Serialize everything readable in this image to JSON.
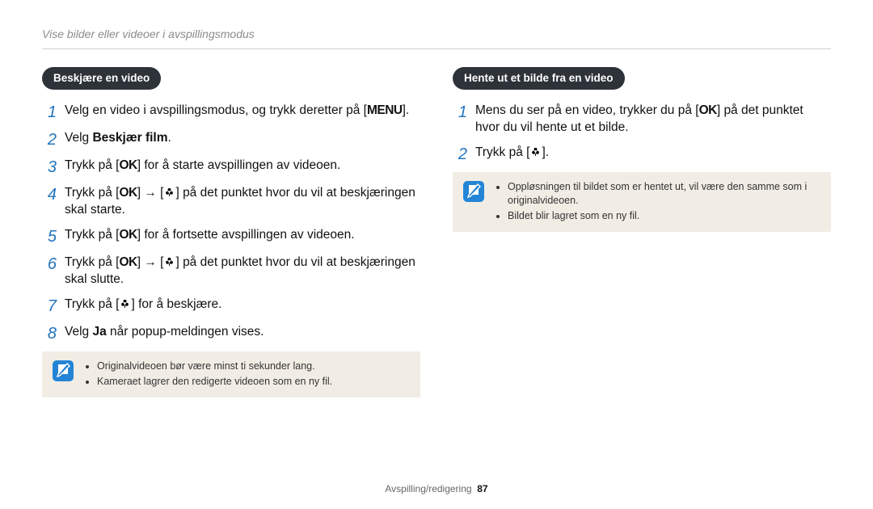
{
  "header": {
    "title": "Vise bilder eller videoer i avspillingsmodus"
  },
  "left": {
    "pill": "Beskjære en video",
    "steps": [
      {
        "n": "1",
        "pre": "Velg en video i avspillingsmodus, og trykk deretter på [",
        "icon": "menu",
        "post": "]."
      },
      {
        "n": "2",
        "pre": "Velg ",
        "bold": "Beskjær film",
        "post": "."
      },
      {
        "n": "3",
        "pre": "Trykk på [",
        "icon": "ok",
        "post": "] for å starte avspillingen av videoen."
      },
      {
        "n": "4",
        "pre": "Trykk på [",
        "icon": "ok",
        "mid": "] → [",
        "icon2": "flower",
        "post": "] på det punktet hvor du vil at beskjæringen skal starte."
      },
      {
        "n": "5",
        "pre": "Trykk på [",
        "icon": "ok",
        "post": "] for å fortsette avspillingen av videoen."
      },
      {
        "n": "6",
        "pre": "Trykk på [",
        "icon": "ok",
        "mid": "] → [",
        "icon2": "flower",
        "post": "] på det punktet hvor du vil at beskjæringen skal slutte."
      },
      {
        "n": "7",
        "pre": "Trykk på [",
        "icon": "flower",
        "post": "] for å beskjære."
      },
      {
        "n": "8",
        "pre": "Velg ",
        "bold": "Ja",
        "post": " når popup-meldingen vises."
      }
    ],
    "notes": [
      "Originalvideoen bør være minst ti sekunder lang.",
      "Kameraet lagrer den redigerte videoen som en ny fil."
    ]
  },
  "right": {
    "pill": "Hente ut et bilde fra en video",
    "steps": [
      {
        "n": "1",
        "pre": "Mens du ser på en video, trykker du på [",
        "icon": "ok",
        "post": "] på det punktet hvor du vil hente ut et bilde."
      },
      {
        "n": "2",
        "pre": "Trykk på [",
        "icon": "flower",
        "post": "]."
      }
    ],
    "notes": [
      "Oppløsningen til bildet som er hentet ut, vil være den samme som i originalvideoen.",
      "Bildet blir lagret som en ny fil."
    ]
  },
  "footer": {
    "section": "Avspilling/redigering",
    "page": "87"
  },
  "icons": {
    "menu": "MENU",
    "ok": "OK"
  }
}
